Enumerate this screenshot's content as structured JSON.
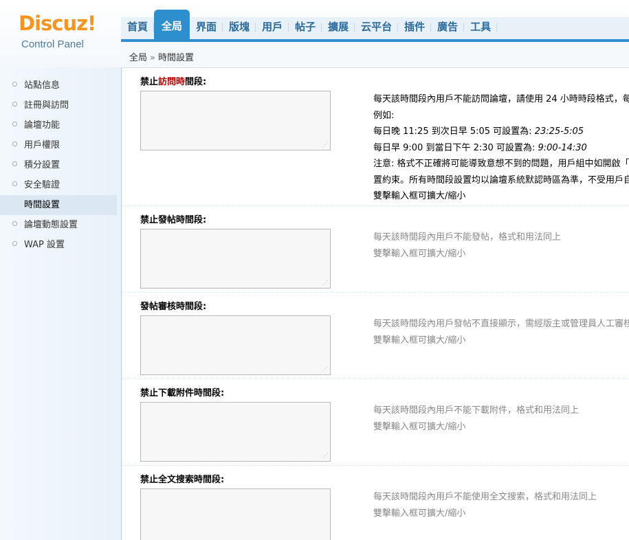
{
  "logo": {
    "main": "Discuz",
    "bang": "!",
    "sub": "Control Panel"
  },
  "nav": {
    "items": [
      {
        "label": "首頁",
        "active": false
      },
      {
        "label": "全局",
        "active": true
      },
      {
        "label": "界面",
        "active": false
      },
      {
        "label": "版塊",
        "active": false
      },
      {
        "label": "用戶",
        "active": false
      },
      {
        "label": "帖子",
        "active": false
      },
      {
        "label": "擴展",
        "active": false
      },
      {
        "label": "云平台",
        "active": false
      },
      {
        "label": "插件",
        "active": false
      },
      {
        "label": "廣告",
        "active": false
      },
      {
        "label": "工具",
        "active": false
      }
    ]
  },
  "breadcrumb": {
    "root": "全局",
    "sep": "»",
    "current": "時間設置"
  },
  "sidebar": {
    "items": [
      {
        "label": "站點信息",
        "active": false
      },
      {
        "label": "註冊與訪問",
        "active": false
      },
      {
        "label": "論壇功能",
        "active": false
      },
      {
        "label": "用戶權限",
        "active": false
      },
      {
        "label": "積分設置",
        "active": false
      },
      {
        "label": "安全驗證",
        "active": false
      },
      {
        "label": "時間設置",
        "active": true
      },
      {
        "label": "論壇動態設置",
        "active": false
      },
      {
        "label": "WAP 設置",
        "active": false
      }
    ]
  },
  "sections": {
    "visit": {
      "title_pre": "禁止",
      "title_hl": "訪問時",
      "title_post": "間段:",
      "value": "",
      "lines": [
        "每天該時間段內用戶不能訪問論壇，請使用 24 小時時段格式，每",
        "例如:",
        "每日晚 11:25 到次日早 5:05 可設置為: ",
        "每日早 9:00 到當日下午 2:30 可設置為: ",
        "注意: 格式不正確將可能導致意想不到的問題，用戶組中如開啟「",
        "置約束。所有時間段設置均以論壇系統默認時區為準，不受用戶自",
        "雙擊輸入框可擴大/縮小"
      ],
      "example1": "23:25-5:05",
      "example2": "9:00-14:30"
    },
    "post": {
      "title": "禁止發帖時間段:",
      "value": "",
      "line1": "每天該時間段內用戶不能發帖，格式和用法同上",
      "line2": "雙擊輸入框可擴大/縮小"
    },
    "moderate": {
      "title": "發帖審核時間段:",
      "value": "",
      "line1": "每天該時間段內用戶發帖不直接顯示，需經版主或管理員人工審核",
      "line2": "雙擊輸入框可擴大/縮小"
    },
    "download": {
      "title": "禁止下載附件時間段:",
      "value": "",
      "line1": "每天該時間段內用戶不能下載附件，格式和用法同上",
      "line2": "雙擊輸入框可擴大/縮小"
    },
    "search": {
      "title": "禁止全文搜索時間段:",
      "value": "",
      "line1": "每天該時間段內用戶不能使用全文搜索，格式和用法同上",
      "line2": "雙擊輸入框可擴大/縮小"
    }
  },
  "colors": {
    "accent": "#2e8fcf",
    "logo": "#f7941d",
    "highlight": "#b50000"
  }
}
